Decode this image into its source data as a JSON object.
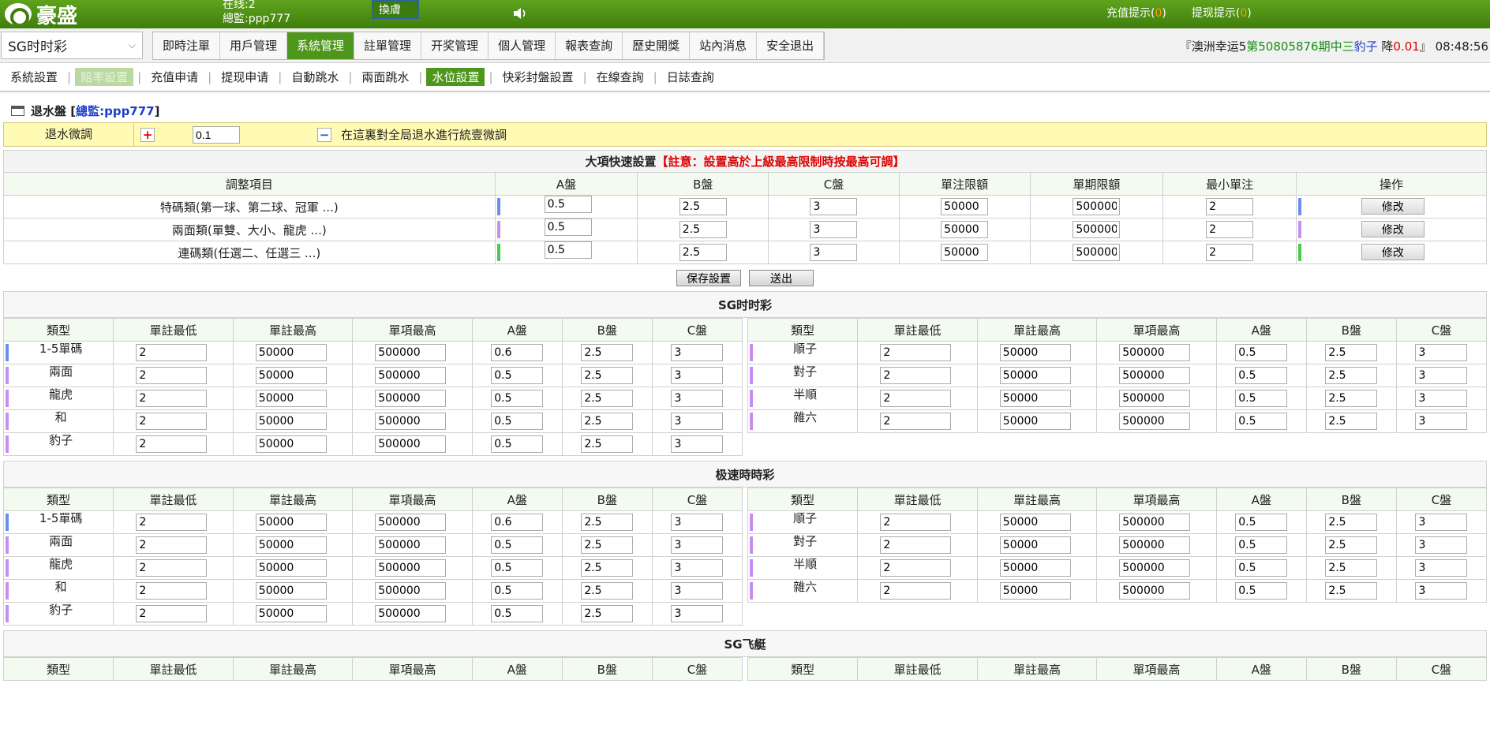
{
  "header": {
    "logo_text": "豪盛",
    "online": "在线:2",
    "agent": "總監:ppp777",
    "swap_button": "換膚",
    "recharge_tip": "充值提示(",
    "recharge_count": "0",
    "withdraw_tip": "提现提示(",
    "withdraw_count": "0",
    "tip_close": ")"
  },
  "game_select": {
    "value": "SG时时彩"
  },
  "main_nav": [
    "即時注單",
    "用戶管理",
    "系統管理",
    "註單管理",
    "开奖管理",
    "個人管理",
    "報表查詢",
    "歷史開獎",
    "站內消息",
    "安全退出"
  ],
  "main_nav_active": 2,
  "ticker": {
    "open": "『澳洲幸运5",
    "prefix": "第",
    "period": "50805876",
    "suffix": "期中三",
    "result": "豹子",
    "drop": " 降",
    "drop_val": "0.01",
    "close": "』",
    "time": "08:48:56"
  },
  "sub_nav": [
    "系統設置",
    "賠率設置",
    "充值申请",
    "提现申请",
    "自動跳水",
    "兩面跳水",
    "水位設置",
    "快彩封盤設置",
    "在線查詢",
    "日誌查詢"
  ],
  "sub_nav_dim": 1,
  "sub_nav_active": 6,
  "page_title": {
    "text": "退水盤",
    "agent": "總監:ppp777"
  },
  "adjust": {
    "label": "退水微調",
    "value": "0.1",
    "note": "在這裏對全局退水進行統壹微調"
  },
  "quick": {
    "title": "大項快速設置",
    "warn": "註意：設置高於上級最高限制時按最高可調",
    "columns": [
      "調整項目",
      "A盤",
      "B盤",
      "C盤",
      "單注限額",
      "單期限額",
      "最小單注",
      "操作"
    ],
    "rows": [
      {
        "name": "特碼類(第一球、第二球、冠軍 ...)",
        "color": "#6a8ef0",
        "a": "0.5",
        "b": "2.5",
        "c": "3",
        "single": "50000",
        "period": "500000",
        "min": "2",
        "action": "修改"
      },
      {
        "name": "兩面類(單雙、大小、龍虎 ...)",
        "color": "#c68ef0",
        "a": "0.5",
        "b": "2.5",
        "c": "3",
        "single": "50000",
        "period": "500000",
        "min": "2",
        "action": "修改"
      },
      {
        "name": "連碼類(任選二、任選三 ...)",
        "color": "#4ec84e",
        "a": "0.5",
        "b": "2.5",
        "c": "3",
        "single": "50000",
        "period": "500000",
        "min": "2",
        "action": "修改"
      }
    ],
    "save": "保存設置",
    "submit": "送出"
  },
  "columns": [
    "類型",
    "單註最低",
    "單註最高",
    "單項最高",
    "A盤",
    "B盤",
    "C盤"
  ],
  "sections": [
    {
      "title": "SG时时彩",
      "left": [
        {
          "type": "1-5單碼",
          "color": "#6a8ef0",
          "min": "2",
          "max": "50000",
          "item": "500000",
          "a": "0.6",
          "b": "2.5",
          "c": "3"
        },
        {
          "type": "兩面",
          "color": "#c68ef0",
          "min": "2",
          "max": "50000",
          "item": "500000",
          "a": "0.5",
          "b": "2.5",
          "c": "3"
        },
        {
          "type": "龍虎",
          "color": "#c68ef0",
          "min": "2",
          "max": "50000",
          "item": "500000",
          "a": "0.5",
          "b": "2.5",
          "c": "3"
        },
        {
          "type": "和",
          "color": "#c68ef0",
          "min": "2",
          "max": "50000",
          "item": "500000",
          "a": "0.5",
          "b": "2.5",
          "c": "3"
        },
        {
          "type": "豹子",
          "color": "#c68ef0",
          "min": "2",
          "max": "50000",
          "item": "500000",
          "a": "0.5",
          "b": "2.5",
          "c": "3"
        }
      ],
      "right": [
        {
          "type": "順子",
          "color": "#c68ef0",
          "min": "2",
          "max": "50000",
          "item": "500000",
          "a": "0.5",
          "b": "2.5",
          "c": "3"
        },
        {
          "type": "對子",
          "color": "#c68ef0",
          "min": "2",
          "max": "50000",
          "item": "500000",
          "a": "0.5",
          "b": "2.5",
          "c": "3"
        },
        {
          "type": "半順",
          "color": "#c68ef0",
          "min": "2",
          "max": "50000",
          "item": "500000",
          "a": "0.5",
          "b": "2.5",
          "c": "3"
        },
        {
          "type": "雜六",
          "color": "#c68ef0",
          "min": "2",
          "max": "50000",
          "item": "500000",
          "a": "0.5",
          "b": "2.5",
          "c": "3"
        }
      ]
    },
    {
      "title": "极速時時彩",
      "left": [
        {
          "type": "1-5單碼",
          "color": "#6a8ef0",
          "min": "2",
          "max": "50000",
          "item": "500000",
          "a": "0.6",
          "b": "2.5",
          "c": "3"
        },
        {
          "type": "兩面",
          "color": "#c68ef0",
          "min": "2",
          "max": "50000",
          "item": "500000",
          "a": "0.5",
          "b": "2.5",
          "c": "3"
        },
        {
          "type": "龍虎",
          "color": "#c68ef0",
          "min": "2",
          "max": "50000",
          "item": "500000",
          "a": "0.5",
          "b": "2.5",
          "c": "3"
        },
        {
          "type": "和",
          "color": "#c68ef0",
          "min": "2",
          "max": "50000",
          "item": "500000",
          "a": "0.5",
          "b": "2.5",
          "c": "3"
        },
        {
          "type": "豹子",
          "color": "#c68ef0",
          "min": "2",
          "max": "50000",
          "item": "500000",
          "a": "0.5",
          "b": "2.5",
          "c": "3"
        }
      ],
      "right": [
        {
          "type": "順子",
          "color": "#c68ef0",
          "min": "2",
          "max": "50000",
          "item": "500000",
          "a": "0.5",
          "b": "2.5",
          "c": "3"
        },
        {
          "type": "對子",
          "color": "#c68ef0",
          "min": "2",
          "max": "50000",
          "item": "500000",
          "a": "0.5",
          "b": "2.5",
          "c": "3"
        },
        {
          "type": "半順",
          "color": "#c68ef0",
          "min": "2",
          "max": "50000",
          "item": "500000",
          "a": "0.5",
          "b": "2.5",
          "c": "3"
        },
        {
          "type": "雜六",
          "color": "#c68ef0",
          "min": "2",
          "max": "50000",
          "item": "500000",
          "a": "0.5",
          "b": "2.5",
          "c": "3"
        }
      ]
    },
    {
      "title": "SG飞艇",
      "left": [],
      "right": []
    }
  ]
}
